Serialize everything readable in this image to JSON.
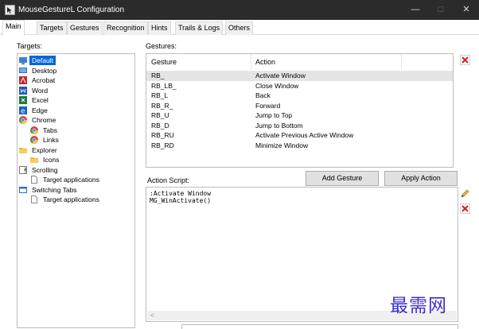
{
  "window": {
    "title": "MouseGestureL Configuration",
    "minimize_glyph": "—",
    "maximize_glyph": "□",
    "close_glyph": "✕"
  },
  "tabs": [
    {
      "label": "Main",
      "active": true
    },
    {
      "label": "Targets"
    },
    {
      "label": "Gestures"
    },
    {
      "label": "Recognition"
    },
    {
      "label": "Hints"
    },
    {
      "label": "Trails & Logs"
    },
    {
      "label": "Others"
    }
  ],
  "targets": {
    "label": "Targets:",
    "items": [
      {
        "label": "Default",
        "icon": "monitor-icon",
        "selected": true
      },
      {
        "label": "Desktop",
        "icon": "desktop-icon"
      },
      {
        "label": "Acrobat",
        "icon": "acrobat-icon"
      },
      {
        "label": "Word",
        "icon": "word-icon"
      },
      {
        "label": "Excel",
        "icon": "excel-icon"
      },
      {
        "label": "Edge",
        "icon": "edge-icon"
      },
      {
        "label": "Chrome",
        "icon": "chrome-icon"
      },
      {
        "label": "Tabs",
        "icon": "chrome-icon"
      },
      {
        "label": "Links",
        "icon": "chrome-icon"
      },
      {
        "label": "Explorer",
        "icon": "folder-icon"
      },
      {
        "label": "Icons",
        "icon": "folder-icon"
      },
      {
        "label": "Scrolling",
        "icon": "scroll-icon"
      },
      {
        "label": "Target applications",
        "icon": "document-icon"
      },
      {
        "label": "Switching Tabs",
        "icon": "window-icon"
      },
      {
        "label": "Target applications",
        "icon": "document-icon"
      }
    ]
  },
  "gestures": {
    "label": "Gestures:",
    "columns": [
      "Gesture",
      "Action"
    ],
    "rows": [
      {
        "gesture": "RB_",
        "action": "Activate Window",
        "selected": true
      },
      {
        "gesture": "RB_LB_",
        "action": "Close Window"
      },
      {
        "gesture": "RB_L",
        "action": "Back"
      },
      {
        "gesture": "RB_R_",
        "action": "Forward"
      },
      {
        "gesture": "RB_U",
        "action": "Jump to Top"
      },
      {
        "gesture": "RB_D",
        "action": "Jump to Bottom"
      },
      {
        "gesture": "RB_RU",
        "action": "Activate Previous Active Window"
      },
      {
        "gesture": "RB_RD",
        "action": "Minimize Window"
      }
    ]
  },
  "buttons": {
    "add_gesture": "Add Gesture",
    "apply_action": "Apply Action"
  },
  "action_script": {
    "label": "Action Script:",
    "lines": [
      ":Activate Window",
      "MG_WinActivate()"
    ]
  },
  "watermark": "最需网",
  "colors": {
    "titlebar": "#2b2b2b",
    "selection": "#0a66d8",
    "delete_red": "#d42020"
  }
}
